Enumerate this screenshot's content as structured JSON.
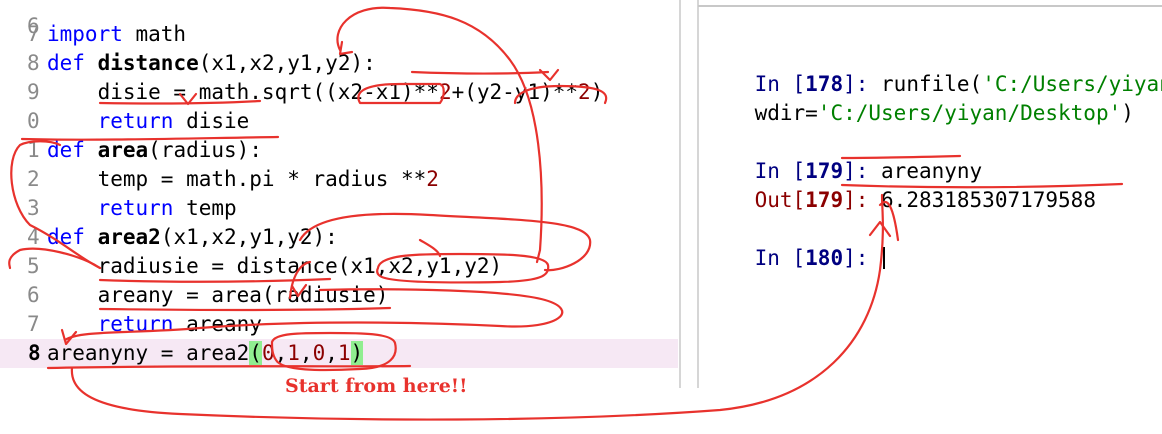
{
  "editor": {
    "top_line_fragment": "6",
    "lines": [
      {
        "num": "7",
        "tokens": [
          {
            "t": "import",
            "c": "kw"
          },
          {
            "t": " math",
            "c": ""
          }
        ]
      },
      {
        "num": "8",
        "tokens": [
          {
            "t": "def",
            "c": "kw"
          },
          {
            "t": " ",
            "c": ""
          },
          {
            "t": "distance",
            "c": "fn"
          },
          {
            "t": "(x1,x2,y1,y2):",
            "c": ""
          }
        ]
      },
      {
        "num": "9",
        "tokens": [
          {
            "t": "    disie = math.sqrt((x2-x1)**",
            "c": ""
          },
          {
            "t": "2",
            "c": "num"
          },
          {
            "t": "+(y2-y1)**",
            "c": ""
          },
          {
            "t": "2",
            "c": "num"
          },
          {
            "t": ")",
            "c": ""
          }
        ]
      },
      {
        "num": "0",
        "tokens": [
          {
            "t": "    ",
            "c": ""
          },
          {
            "t": "return",
            "c": "kw"
          },
          {
            "t": " disie",
            "c": ""
          }
        ]
      },
      {
        "num": "1",
        "tokens": [
          {
            "t": "def",
            "c": "kw"
          },
          {
            "t": " ",
            "c": ""
          },
          {
            "t": "area",
            "c": "fn"
          },
          {
            "t": "(radius):",
            "c": ""
          }
        ]
      },
      {
        "num": "2",
        "tokens": [
          {
            "t": "    temp = math.pi * radius **",
            "c": ""
          },
          {
            "t": "2",
            "c": "num"
          }
        ]
      },
      {
        "num": "3",
        "tokens": [
          {
            "t": "    ",
            "c": ""
          },
          {
            "t": "return",
            "c": "kw"
          },
          {
            "t": " temp",
            "c": ""
          }
        ]
      },
      {
        "num": "4",
        "tokens": [
          {
            "t": "def",
            "c": "kw"
          },
          {
            "t": " ",
            "c": ""
          },
          {
            "t": "area2",
            "c": "fn"
          },
          {
            "t": "(x1,x2,y1,y2):",
            "c": ""
          }
        ]
      },
      {
        "num": "5",
        "tokens": [
          {
            "t": "    radiusie = distance(x1,x2,y1,y2)",
            "c": ""
          }
        ]
      },
      {
        "num": "6",
        "tokens": [
          {
            "t": "    areany = area(radiusie)",
            "c": ""
          }
        ]
      },
      {
        "num": "7",
        "tokens": [
          {
            "t": "    ",
            "c": ""
          },
          {
            "t": "return",
            "c": "kw"
          },
          {
            "t": " areany",
            "c": ""
          }
        ]
      },
      {
        "num": "8",
        "current": true,
        "tokens": [
          {
            "t": "areanyny = area2",
            "c": ""
          },
          {
            "t": "(",
            "c": "match"
          },
          {
            "t": "0",
            "c": "num"
          },
          {
            "t": ",",
            "c": ""
          },
          {
            "t": "1",
            "c": "num"
          },
          {
            "t": ",",
            "c": ""
          },
          {
            "t": "0",
            "c": "num"
          },
          {
            "t": ",",
            "c": ""
          },
          {
            "t": "1",
            "c": "num"
          },
          {
            "t": ")",
            "c": "match"
          }
        ]
      }
    ]
  },
  "console": {
    "in_label": "In [",
    "out_label": "Out[",
    "close_label": "]: ",
    "entries": [
      {
        "n": "178",
        "command": "runfile(",
        "arg1": "'C:/Users/yiyan",
        "line2_pre": "wdir=",
        "line2_str": "'C:/Users/yiyan/Desktop'",
        "line2_post": ")"
      },
      {
        "n": "179",
        "command": "areanyny",
        "output": "6.283185307179588"
      },
      {
        "n": "180",
        "command": ""
      }
    ]
  },
  "annotation": {
    "text": "Start from here!!",
    "color": "#e8322d"
  },
  "colors": {
    "keyword": "#0000ff",
    "number": "#8b0000",
    "string": "#008000",
    "in_prompt": "#000080",
    "out_prompt": "#8b0000",
    "current_line": "#f6e8f4",
    "bracket_match": "#90ee90"
  }
}
